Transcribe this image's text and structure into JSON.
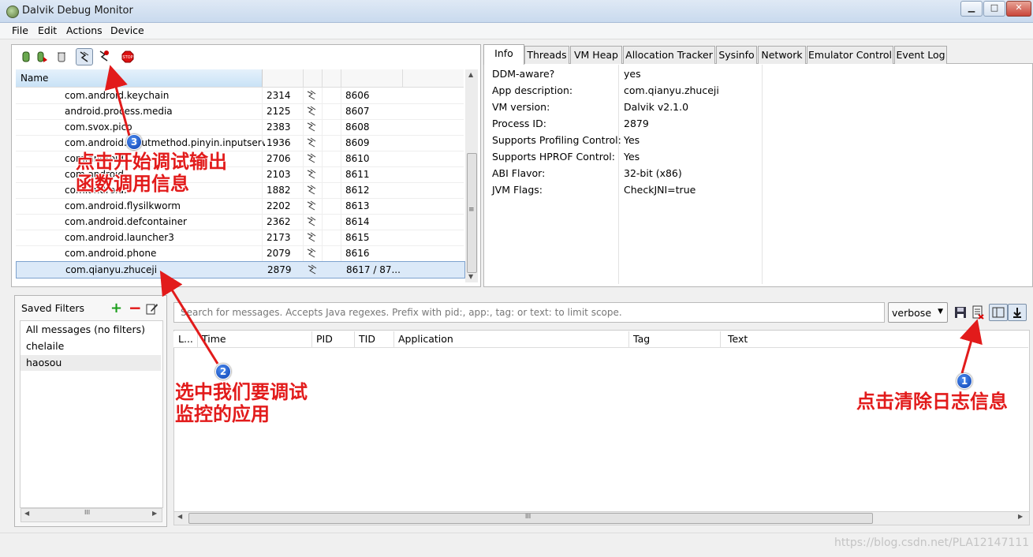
{
  "window": {
    "title": "Dalvik Debug Monitor",
    "min": "▁",
    "max": "□",
    "close": "✕"
  },
  "menu": [
    "File",
    "Edit",
    "Actions",
    "Device"
  ],
  "devices": {
    "header": "Name",
    "rows": [
      {
        "name": "com.android.keychain",
        "pid": "2314",
        "port": "8606"
      },
      {
        "name": "android.process.media",
        "pid": "2125",
        "port": "8607"
      },
      {
        "name": "com.svox.pico",
        "pid": "2383",
        "port": "8608"
      },
      {
        "name": "com.android.inputmethod.pinyin.inputservice",
        "pid": "1936",
        "port": "8609"
      },
      {
        "name": "com.android.",
        "pid": "2706",
        "port": "8610"
      },
      {
        "name": "com.android.",
        "pid": "2103",
        "port": "8611"
      },
      {
        "name": "com.android.",
        "pid": "1882",
        "port": "8612"
      },
      {
        "name": "com.android.flysilkworm",
        "pid": "2202",
        "port": "8613"
      },
      {
        "name": "com.android.defcontainer",
        "pid": "2362",
        "port": "8614"
      },
      {
        "name": "com.android.launcher3",
        "pid": "2173",
        "port": "8615"
      },
      {
        "name": "com.android.phone",
        "pid": "2079",
        "port": "8616"
      },
      {
        "name": "com.qianyu.zhuceji",
        "pid": "2879",
        "port": "8617 / 87..."
      }
    ]
  },
  "tabs": [
    "Info",
    "Threads",
    "VM Heap",
    "Allocation Tracker",
    "Sysinfo",
    "Network",
    "Emulator Control",
    "Event Log"
  ],
  "info": [
    {
      "k": "DDM-aware?",
      "v": "yes"
    },
    {
      "k": "App description:",
      "v": "com.qianyu.zhuceji"
    },
    {
      "k": "VM version:",
      "v": "Dalvik v2.1.0"
    },
    {
      "k": "Process ID:",
      "v": "2879"
    },
    {
      "k": "Supports Profiling Control:",
      "v": "Yes"
    },
    {
      "k": "Supports HPROF Control:",
      "v": "Yes"
    },
    {
      "k": "ABI Flavor:",
      "v": "32-bit (x86)"
    },
    {
      "k": "JVM Flags:",
      "v": "CheckJNI=true"
    }
  ],
  "filters": {
    "title": "Saved Filters",
    "items": [
      "All messages (no filters)",
      "chelaile",
      "haosou"
    ]
  },
  "logcat": {
    "search_placeholder": "Search for messages. Accepts Java regexes. Prefix with pid:, app:, tag: or text: to limit scope.",
    "level": "verbose",
    "columns": [
      "L...",
      "Time",
      "PID",
      "TID",
      "Application",
      "Tag",
      "Text"
    ]
  },
  "annotations": {
    "a1": "点击清除日志信息",
    "a2_line1": "选中我们要调试",
    "a2_line2": "监控的应用",
    "a3_line1": "点击开始调试输出",
    "a3_line2": "函数调用信息",
    "n1": "1",
    "n2": "2",
    "n3": "3"
  },
  "watermark": "https://blog.csdn.net/PLA12147111",
  "scroll_marks": {
    "grip": "≡",
    "hgrip": "III",
    "up": "▲",
    "down": "▼",
    "left": "◀",
    "right": "▶"
  }
}
